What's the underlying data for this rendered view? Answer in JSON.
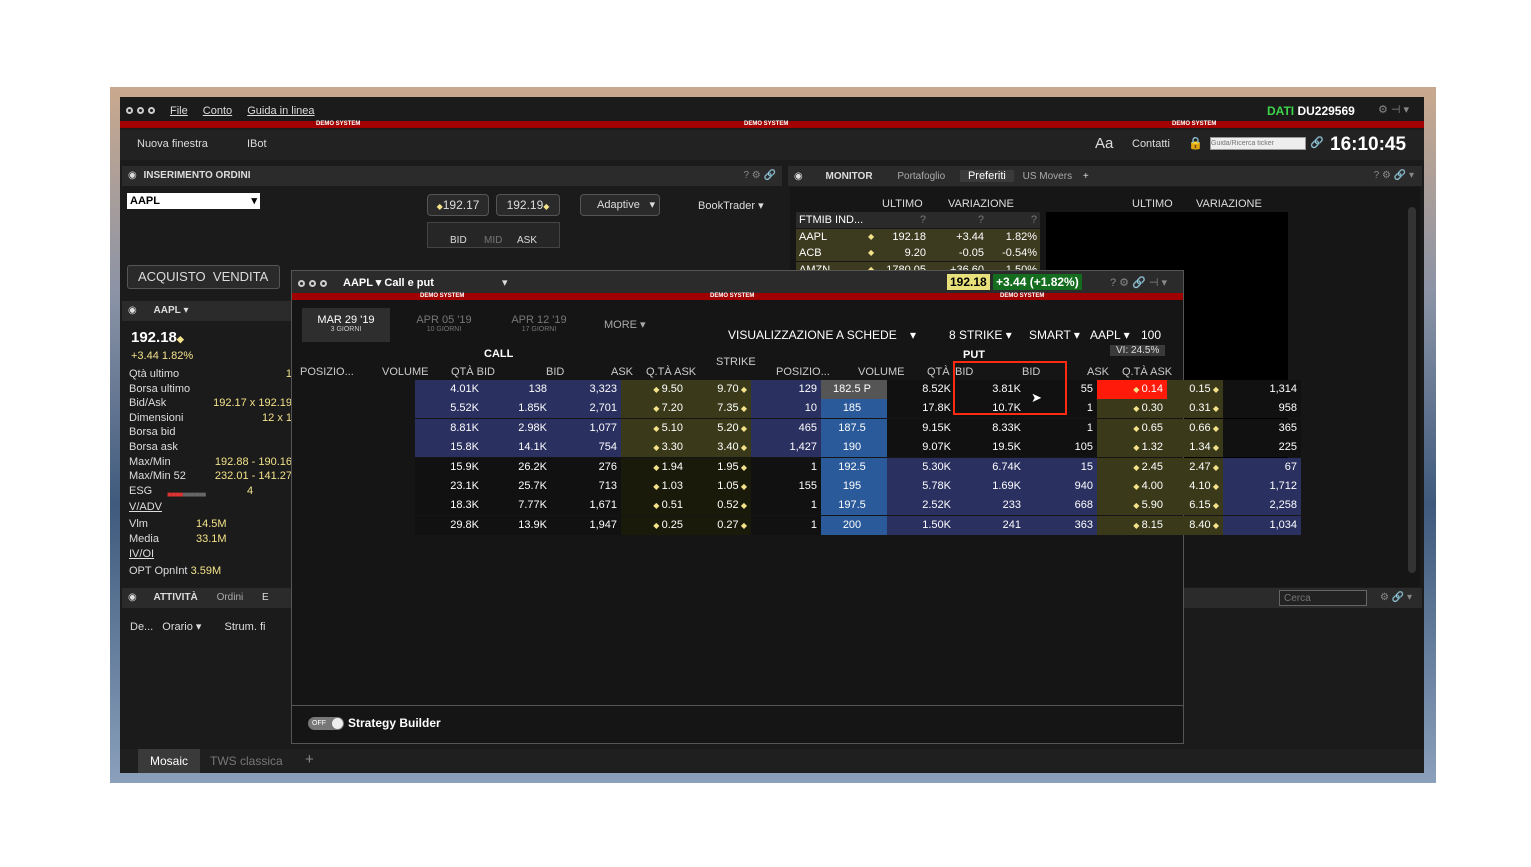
{
  "menu": {
    "file": "File",
    "conto": "Conto",
    "guida": "Guida in linea"
  },
  "account": {
    "dati": "DATI",
    "id": "DU229569"
  },
  "demo": "DEMO SYSTEM",
  "toolbar": {
    "nuova": "Nuova finestra",
    "ibot": "IBot",
    "aa": "Aa",
    "contatti": "Contatti",
    "search_placeholder": "Guida/Ricerca ticker",
    "time": "16:10:45"
  },
  "orders": {
    "title": "INSERIMENTO ORDINI",
    "symbol": "AAPL",
    "bid": "192.17",
    "ask": "192.19",
    "adaptive": "Adaptive",
    "booktrader": "BookTrader",
    "bid_lbl": "BID",
    "mid_lbl": "MID",
    "ask_lbl": "ASK",
    "acquisto": "ACQUISTO",
    "vendita": "VENDITA"
  },
  "monitor": {
    "title": "MONITOR",
    "tabs": [
      "Portafoglio",
      "Preferiti",
      "US Movers"
    ],
    "cols": {
      "ultimo": "ULTIMO",
      "variazione": "VARIAZIONE"
    },
    "rows": [
      {
        "sym": "FTMIB IND...",
        "last": "?",
        "chg": "?",
        "pct": "?"
      },
      {
        "sym": "AAPL",
        "last": "192.18",
        "chg": "+3.44",
        "pct": "1.82%"
      },
      {
        "sym": "ACB",
        "last": "9.20",
        "chg": "-0.05",
        "pct": "-0.54%"
      },
      {
        "sym": "AMZN",
        "last": "1780.05",
        "chg": "+36.60",
        "pct": "1.50%"
      }
    ]
  },
  "quote": {
    "symbol": "AAPL",
    "price": "192.18",
    "change": "+3.44",
    "pct": "1.82%",
    "fields": [
      {
        "k": "Qtà ultimo",
        "v": "1"
      },
      {
        "k": "Borsa ultimo",
        "v": ""
      },
      {
        "k": "Bid/Ask",
        "v": "192.17 x 192.19"
      },
      {
        "k": "Dimensioni",
        "v": "12 x 1"
      },
      {
        "k": "Borsa bid",
        "v": ""
      },
      {
        "k": "Borsa ask",
        "v": ""
      },
      {
        "k": "Max/Min",
        "v": "192.88 - 190.16"
      },
      {
        "k": "Max/Min 52",
        "v": "232.01 - 141.27"
      },
      {
        "k": "ESG",
        "v": "4"
      }
    ],
    "vadv": "V/ADV",
    "vlm_k": "Vlm",
    "vlm_v": "14.5M",
    "media_k": "Media",
    "media_v": "33.1M",
    "ivoi": "IV/OI",
    "opt_k": "OPT OpnInt",
    "opt_v": "3.59M"
  },
  "activity": {
    "title": "ATTIVITÀ",
    "tab2": "Ordini",
    "tab3": "E",
    "col1": "De...",
    "col2": "Orario",
    "col3": "Strum. fi",
    "search": "Cerca"
  },
  "options": {
    "title": "AAPL",
    "subtitle": "Call e put",
    "last": "192.18",
    "change": "+3.44 (+1.82%)",
    "expiries": [
      {
        "d": "MAR 29 '19",
        "g": "3 GIORNI"
      },
      {
        "d": "APR 05 '19",
        "g": "10 GIORNI"
      },
      {
        "d": "APR 12 '19",
        "g": "17 GIORNI"
      }
    ],
    "more": "MORE",
    "vis": "VISUALIZZAZIONE A SCHEDE",
    "strike_cnt": "8 STRIKE",
    "smart": "SMART",
    "und": "AAPL",
    "qty": "100",
    "vi": "VI: 24.5%",
    "call": "CALL",
    "put": "PUT",
    "strike_hdr": "STRIKE",
    "headers": {
      "pos": "POSIZIO...",
      "vol": "VOLUME",
      "qbid": "QTÀ BID",
      "bid": "BID",
      "ask": "ASK",
      "qask": "Q.TÀ ASK"
    },
    "rows": [
      {
        "cpos": "4.01K",
        "cvol": "138",
        "cqb": "3,323",
        "cbid": "9.50",
        "cask": "9.70",
        "cqa": "129",
        "strike": "182.5",
        "ppos": "8.52K",
        "pvol": "3.81K",
        "pqb": "55",
        "pbid": "0.14",
        "pask": "0.15",
        "pqa": "1,314"
      },
      {
        "cpos": "5.52K",
        "cvol": "1.85K",
        "cqb": "2,701",
        "cbid": "7.20",
        "cask": "7.35",
        "cqa": "10",
        "strike": "185",
        "ppos": "17.8K",
        "pvol": "10.7K",
        "pqb": "1",
        "pbid": "0.30",
        "pask": "0.31",
        "pqa": "958"
      },
      {
        "cpos": "8.81K",
        "cvol": "2.98K",
        "cqb": "1,077",
        "cbid": "5.10",
        "cask": "5.20",
        "cqa": "465",
        "strike": "187.5",
        "ppos": "9.15K",
        "pvol": "8.33K",
        "pqb": "1",
        "pbid": "0.65",
        "pask": "0.66",
        "pqa": "365"
      },
      {
        "cpos": "15.8K",
        "cvol": "14.1K",
        "cqb": "754",
        "cbid": "3.30",
        "cask": "3.40",
        "cqa": "1,427",
        "strike": "190",
        "ppos": "9.07K",
        "pvol": "19.5K",
        "pqb": "105",
        "pbid": "1.32",
        "pask": "1.34",
        "pqa": "225"
      },
      {
        "cpos": "15.9K",
        "cvol": "26.2K",
        "cqb": "276",
        "cbid": "1.94",
        "cask": "1.95",
        "cqa": "1",
        "strike": "192.5",
        "ppos": "5.30K",
        "pvol": "6.74K",
        "pqb": "15",
        "pbid": "2.45",
        "pask": "2.47",
        "pqa": "67"
      },
      {
        "cpos": "23.1K",
        "cvol": "25.7K",
        "cqb": "713",
        "cbid": "1.03",
        "cask": "1.05",
        "cqa": "155",
        "strike": "195",
        "ppos": "5.78K",
        "pvol": "1.69K",
        "pqb": "940",
        "pbid": "4.00",
        "pask": "4.10",
        "pqa": "1,712"
      },
      {
        "cpos": "18.3K",
        "cvol": "7.77K",
        "cqb": "1,671",
        "cbid": "0.51",
        "cask": "0.52",
        "cqa": "1",
        "strike": "197.5",
        "ppos": "2.52K",
        "pvol": "233",
        "pqb": "668",
        "pbid": "5.90",
        "pask": "6.15",
        "pqa": "2,258"
      },
      {
        "cpos": "29.8K",
        "cvol": "13.9K",
        "cqb": "1,947",
        "cbid": "0.25",
        "cask": "0.27",
        "cqa": "1",
        "strike": "200",
        "ppos": "1.50K",
        "pvol": "241",
        "pqb": "363",
        "pbid": "8.15",
        "pask": "8.40",
        "pqa": "1,034"
      }
    ],
    "strike_p": "P",
    "sb_toggle": "OFF",
    "sb_label": "Strategy Builder"
  },
  "bottom_tabs": [
    "Mosaic",
    "TWS classica"
  ]
}
